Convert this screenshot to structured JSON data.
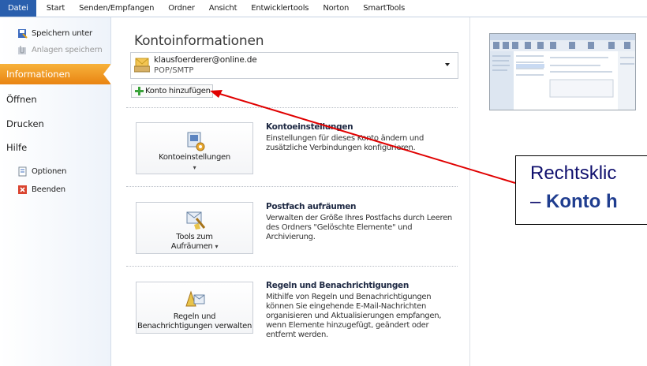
{
  "ribbon": {
    "tabs": [
      "Datei",
      "Start",
      "Senden/Empfangen",
      "Ordner",
      "Ansicht",
      "Entwicklertools",
      "Norton",
      "SmartTools"
    ]
  },
  "nav": {
    "save_as": "Speichern unter",
    "save_attachments": "Anlagen speichern",
    "info": "Informationen",
    "open": "Öffnen",
    "print": "Drucken",
    "help": "Hilfe",
    "options": "Optionen",
    "exit": "Beenden"
  },
  "main": {
    "title": "Kontoinformationen",
    "account": {
      "email": "klausfoerderer@online.de",
      "type": "POP/SMTP"
    },
    "add_account": "Konto hinzufügen",
    "sections": [
      {
        "button_label": "Kontoeinstellungen",
        "heading": "Kontoeinstellungen",
        "description": "Einstellungen für dieses Konto ändern und zusätzliche Verbindungen konfigurieren."
      },
      {
        "button_label_1": "Tools zum",
        "button_label_2": "Aufräumen",
        "heading": "Postfach aufräumen",
        "description": "Verwalten der Größe Ihres Postfachs durch Leeren des Ordners \"Gelöschte Elemente\" und Archivierung."
      },
      {
        "button_label_1": "Regeln und",
        "button_label_2": "Benachrichtigungen verwalten",
        "heading": "Regeln und Benachrichtigungen",
        "description": "Mithilfe von Regeln und Benachrichtigungen können Sie eingehende E-Mail-Nachrichten organisieren und Aktualisierungen empfangen, wenn Elemente hinzugefügt, geändert oder entfernt werden."
      }
    ]
  },
  "callout": {
    "line1": "Rechtsklic",
    "line2_prefix": "– ",
    "line2_bold": "Konto h"
  },
  "colors": {
    "file_tab": "#2a5fad",
    "selected_nav": "#f0a02a",
    "arrow": "#e00000",
    "callout_text": "#10106e"
  }
}
